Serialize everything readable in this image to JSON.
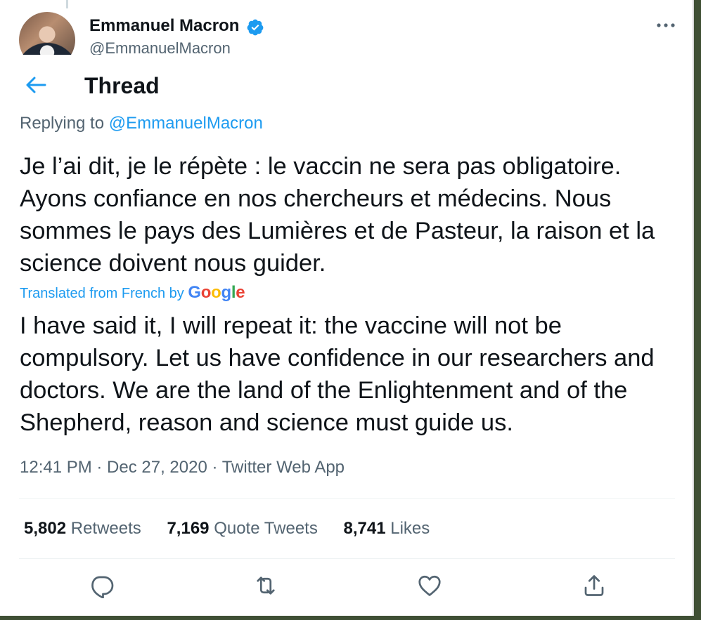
{
  "author": {
    "name": "Emmanuel Macron",
    "handle": "@EmmanuelMacron"
  },
  "header": {
    "title": "Thread"
  },
  "reply": {
    "prefix": "Replying to",
    "mention": "@EmmanuelMacron"
  },
  "tweet": {
    "text": "Je l’ai dit, je le répète : le vaccin ne sera pas obligatoire. Ayons confiance en nos chercheurs et médecins. Nous sommes le pays des Lumières et de Pasteur, la raison et la science doivent nous guider.",
    "translated_label": "Translated from French by",
    "translation_provider": "Google",
    "translation": "I have said it, I will repeat it: the vaccine will not be compulsory. Let us have confidence in our researchers and doctors. We are the land of the Enlightenment and of the Shepherd, reason and science must guide us.",
    "timestamp": "12:41 PM · Dec 27, 2020 · Twitter Web App"
  },
  "stats": {
    "retweets_count": "5,802",
    "retweets_label": "Retweets",
    "quotes_count": "7,169",
    "quotes_label": "Quote Tweets",
    "likes_count": "8,741",
    "likes_label": "Likes"
  },
  "icons": {
    "verified": "verified-badge-icon",
    "more": "more-options-icon",
    "back": "back-arrow-icon",
    "reply": "reply-icon",
    "retweet": "retweet-icon",
    "like": "like-icon",
    "share": "share-icon"
  },
  "colors": {
    "accent": "#1d9bf0",
    "secondary_text": "#536471",
    "primary_text": "#0f1419",
    "frame": "#3f4f34"
  }
}
